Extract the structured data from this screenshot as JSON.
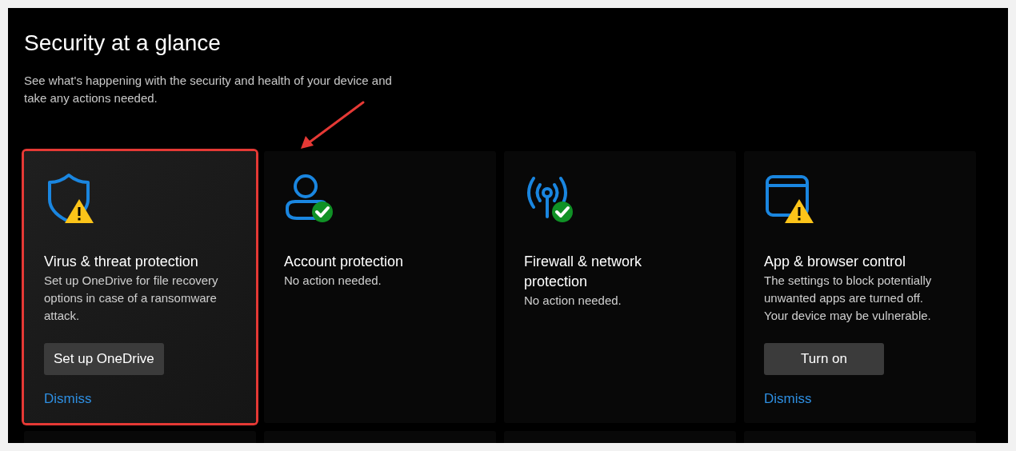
{
  "page": {
    "title": "Security at a glance",
    "subtitle": "See what's happening with the security and health of your device and take any actions needed."
  },
  "annotation": {
    "arrow_shown": true
  },
  "cards": [
    {
      "kind": "warning",
      "highlighted": true,
      "title": "Virus & threat protection",
      "description": "Set up OneDrive for file recovery options in case of a ransomware attack.",
      "button": "Set up OneDrive",
      "link": "Dismiss"
    },
    {
      "kind": "ok",
      "highlighted": false,
      "title": "Account protection",
      "description": "No action needed."
    },
    {
      "kind": "ok",
      "highlighted": false,
      "title": "Firewall & network protection",
      "description": "No action needed."
    },
    {
      "kind": "warning",
      "highlighted": false,
      "title": "App & browser control",
      "description": "The settings to block potentially unwanted apps are turned off. Your device may be vulnerable.",
      "button": "Turn on",
      "link": "Dismiss"
    }
  ],
  "lower_cards": [
    {
      "kind": "card"
    },
    {
      "kind": "card"
    },
    {
      "kind": "card"
    },
    {
      "kind": "card"
    }
  ]
}
